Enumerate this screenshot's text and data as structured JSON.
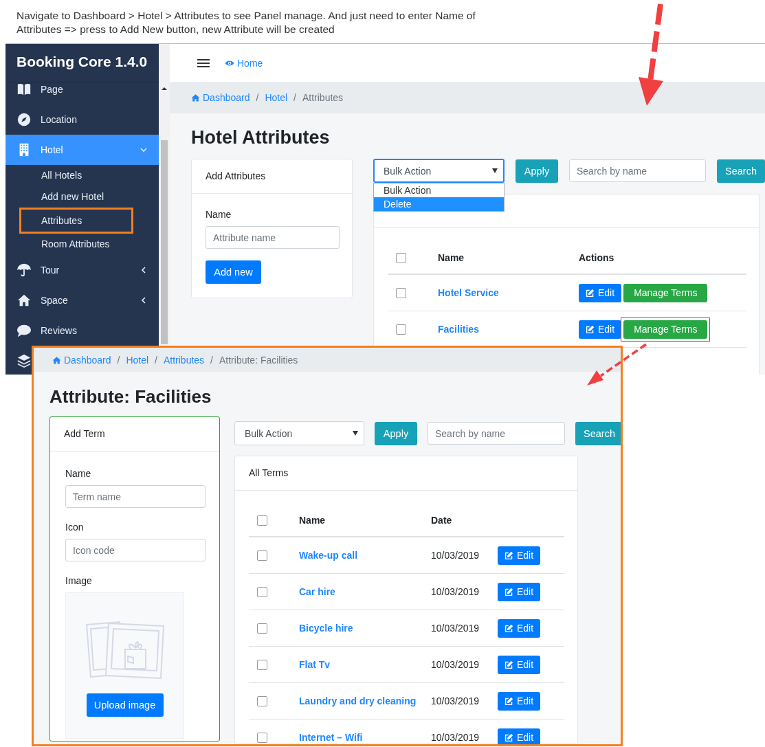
{
  "caption": "Navigate to Dashboard > Hotel > Attributes to see Panel manage. And just need to enter Name of Attributes => press to Add New button, new Attribute will be created",
  "app": {
    "logo": "Booking Core 1.4.0",
    "sidebar": {
      "items": [
        {
          "label": "Page",
          "selected": false
        },
        {
          "label": "Location",
          "selected": false
        },
        {
          "label": "Hotel",
          "selected": true,
          "expanded": true,
          "children": [
            {
              "label": "All Hotels",
              "highlighted": false
            },
            {
              "label": "Add new Hotel",
              "highlighted": false
            },
            {
              "label": "Attributes",
              "highlighted": true
            },
            {
              "label": "Room Attributes",
              "highlighted": false
            }
          ]
        },
        {
          "label": "Tour",
          "selected": false,
          "expanded": false
        },
        {
          "label": "Space",
          "selected": false,
          "expanded": false
        },
        {
          "label": "Reviews",
          "selected": false
        }
      ]
    },
    "topbar": {
      "home_link": "Home"
    },
    "breadcrumb": {
      "separator": "/",
      "items": [
        {
          "label": "Dashboard",
          "link": true
        },
        {
          "label": "Hotel",
          "link": true
        },
        {
          "label": "Attributes",
          "link": false
        }
      ]
    },
    "title": "Hotel Attributes",
    "add_card": {
      "title": "Add Attributes",
      "field_label": "Name",
      "placeholder": "Attribute name",
      "button": "Add new"
    },
    "toolbar": {
      "bulk_select": "Bulk Action",
      "apply": "Apply",
      "search_placeholder": "Search by name",
      "search_button": "Search"
    },
    "dropdown": {
      "open": true,
      "options": [
        {
          "label": "Bulk Action",
          "selected": false
        },
        {
          "label": "Delete",
          "selected": true
        }
      ]
    },
    "table": {
      "header_checked": false,
      "columns": [
        "Name",
        "Actions"
      ],
      "rows": [
        {
          "name": "Hotel Service",
          "checked": false,
          "edit": "Edit",
          "manage": "Manage Terms",
          "highlighted": false
        },
        {
          "name": "Facilities",
          "checked": false,
          "edit": "Edit",
          "manage": "Manage Terms",
          "highlighted": true
        }
      ]
    }
  },
  "inset": {
    "breadcrumb": {
      "separator": "/",
      "items": [
        {
          "label": "Dashboard",
          "link": true
        },
        {
          "label": "Hotel",
          "link": true
        },
        {
          "label": "Attributes",
          "link": true
        },
        {
          "label": "Attribute: Facilities",
          "link": false
        }
      ]
    },
    "title": "Attribute: Facilities",
    "add_term": {
      "title": "Add Term",
      "fields": [
        {
          "label": "Name",
          "placeholder": "Term name"
        },
        {
          "label": "Icon",
          "placeholder": "Icon code"
        }
      ],
      "image_label": "Image",
      "upload_button": "Upload image"
    },
    "toolbar": {
      "bulk_select": "Bulk Action",
      "apply": "Apply",
      "search_placeholder": "Search by name",
      "search_button": "Search"
    },
    "table": {
      "title": "All Terms",
      "header_checked": false,
      "columns": [
        "Name",
        "Date"
      ],
      "rows": [
        {
          "name": "Wake-up call",
          "date": "10/03/2019",
          "checked": false,
          "edit": "Edit"
        },
        {
          "name": "Car hire",
          "date": "10/03/2019",
          "checked": false,
          "edit": "Edit"
        },
        {
          "name": "Bicycle hire",
          "date": "10/03/2019",
          "checked": false,
          "edit": "Edit"
        },
        {
          "name": "Flat Tv",
          "date": "10/03/2019",
          "checked": false,
          "edit": "Edit"
        },
        {
          "name": "Laundry and dry cleaning",
          "date": "10/03/2019",
          "checked": false,
          "edit": "Edit"
        },
        {
          "name": "Internet – Wifi",
          "date": "10/03/2019",
          "checked": false,
          "edit": "Edit"
        }
      ]
    }
  }
}
